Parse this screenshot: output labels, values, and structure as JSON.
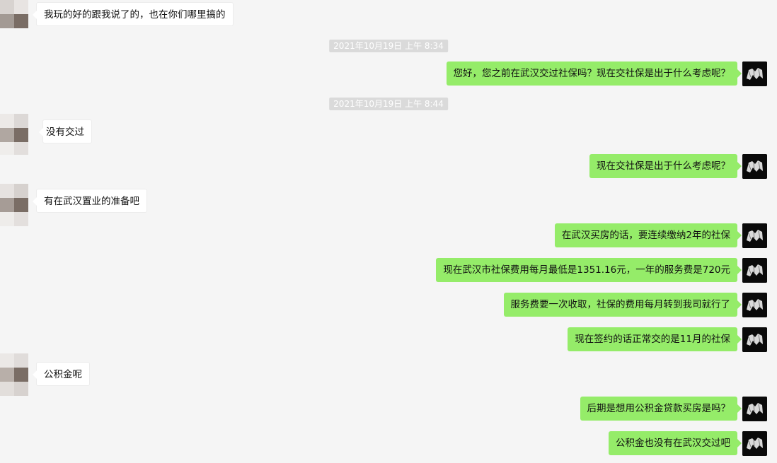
{
  "chat": {
    "messages": [
      {
        "text": "我玩的好的跟我说了的，也在你们哪里搞的",
        "direction": "in"
      },
      {
        "timestamp": "2021年10月19日 上午 8:34"
      },
      {
        "text": "您好，您之前在武汉交过社保吗？现在交社保是出于什么考虑呢？",
        "direction": "out"
      },
      {
        "timestamp": "2021年10月19日 上午 8:44"
      },
      {
        "text": "没有交过",
        "direction": "in"
      },
      {
        "text": "现在交社保是出于什么考虑呢？",
        "direction": "out"
      },
      {
        "text": "有在武汉置业的准备吧",
        "direction": "in"
      },
      {
        "text": "在武汉买房的话，要连续缴纳2年的社保",
        "direction": "out"
      },
      {
        "text": "现在武汉市社保费用每月最低是1351.16元，一年的服务费是720元",
        "direction": "out"
      },
      {
        "text": "服务费要一次收取，社保的费用每月转到我司就行了",
        "direction": "out"
      },
      {
        "text": "现在签约的话正常交的是11月的社保",
        "direction": "out"
      },
      {
        "text": "公积金呢",
        "direction": "in"
      },
      {
        "text": "后期是想用公积金贷款买房是吗？",
        "direction": "out"
      },
      {
        "text": "公积金也没有在武汉交过吧",
        "direction": "out"
      }
    ]
  },
  "colors": {
    "background": "#f5f5f5",
    "outgoing_bubble": "#95ec69",
    "incoming_bubble": "#ffffff",
    "timestamp_bg": "#dadada"
  },
  "icons": {
    "contact_avatar": "pixelated-avatar-icon",
    "self_avatar": "dark-photo-avatar-icon"
  }
}
